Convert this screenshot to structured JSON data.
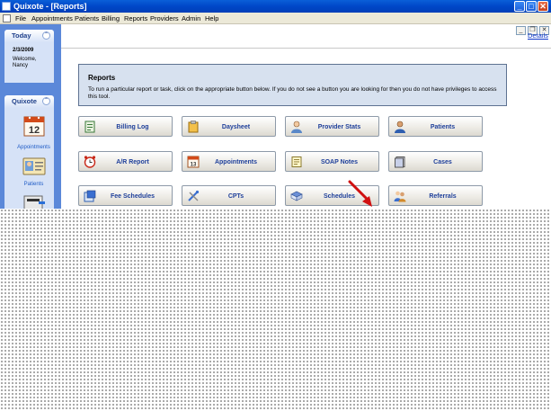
{
  "window": {
    "title": "Quixote - [Reports]",
    "minimize": "_",
    "maximize": "□",
    "close": "✕"
  },
  "menu": [
    "File",
    "Appointments",
    "Patients",
    "Billing",
    "Reports",
    "Providers",
    "Admin",
    "Help"
  ],
  "sidebar": {
    "today_header": "Today",
    "date": "2/3/2009",
    "welcome": "Welcome,",
    "user": "Nancy",
    "quixote_header": "Quixote",
    "calendar_day": "12",
    "nav": [
      {
        "label": "Appointments",
        "icon": "calendar-icon"
      },
      {
        "label": "Patients",
        "icon": "patient-card-icon"
      }
    ]
  },
  "main": {
    "details_link": "Details",
    "reports_title": "Reports",
    "reports_desc": "To run a particular report or task, click on the appropriate button below.  If you do not see a button you are looking for then you do not have privileges to access this tool.",
    "buttons": [
      {
        "label": "Billing Log",
        "icon": "ledger-icon"
      },
      {
        "label": "Daysheet",
        "icon": "clipboard-icon"
      },
      {
        "label": "Provider Stats",
        "icon": "person-icon"
      },
      {
        "label": "Patients",
        "icon": "person-icon"
      },
      {
        "label": "A/R Report",
        "icon": "alarm-clock-icon"
      },
      {
        "label": "Appointments",
        "icon": "calendar-icon"
      },
      {
        "label": "SOAP Notes",
        "icon": "notes-icon"
      },
      {
        "label": "Cases",
        "icon": "folder-icon"
      },
      {
        "label": "Fee Schedules",
        "icon": "fee-sheet-icon"
      },
      {
        "label": "CPTs",
        "icon": "tools-icon"
      },
      {
        "label": "Schedules",
        "icon": "book-icon"
      },
      {
        "label": "Referrals",
        "icon": "people-icon"
      }
    ]
  },
  "colors": {
    "titlebar": "#0047c8",
    "sidebar": "#5b88d9",
    "reports_box": "#d7e1ef",
    "button_text": "#1e3f9a",
    "arrow": "#d01010"
  }
}
